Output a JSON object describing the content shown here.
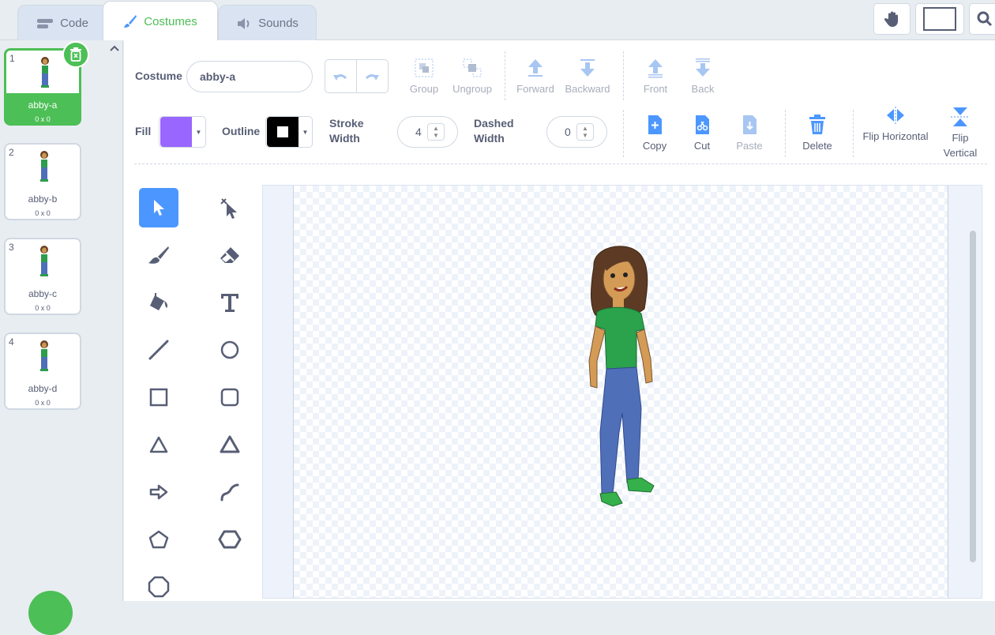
{
  "tabs": [
    {
      "label": "Code",
      "icon": "code-icon"
    },
    {
      "label": "Costumes",
      "icon": "brush-icon"
    },
    {
      "label": "Sounds",
      "icon": "speaker-icon"
    }
  ],
  "costumes": [
    {
      "num": "1",
      "name": "abby-a",
      "size": "0 x 0",
      "selected": true
    },
    {
      "num": "2",
      "name": "abby-b",
      "size": "0 x 0"
    },
    {
      "num": "3",
      "name": "abby-c",
      "size": "0 x 0"
    },
    {
      "num": "4",
      "name": "abby-d",
      "size": "0 x 0"
    }
  ],
  "editor": {
    "costume_label": "Costume",
    "costume_name": "abby-a",
    "fill_label": "Fill",
    "fill_color": "#9966ff",
    "outline_label": "Outline",
    "outline_color": "#000000",
    "stroke_width_label": "Stroke Width",
    "stroke_width_value": "4",
    "dashed_width_label": "Dashed Width",
    "dashed_width_value": "0",
    "tools_row1": {
      "group": "Group",
      "ungroup": "Ungroup",
      "forward": "Forward",
      "backward": "Backward",
      "front": "Front",
      "back": "Back"
    },
    "tools_row2": {
      "copy": "Copy",
      "cut": "Cut",
      "paste": "Paste",
      "delete": "Delete",
      "flip_h": "Flip Horizontal",
      "flip_v": "Flip Vertical"
    }
  },
  "colors": {
    "accent_green": "#4cbf56",
    "selected_tool": "#4c97ff",
    "text": "#575e75"
  }
}
